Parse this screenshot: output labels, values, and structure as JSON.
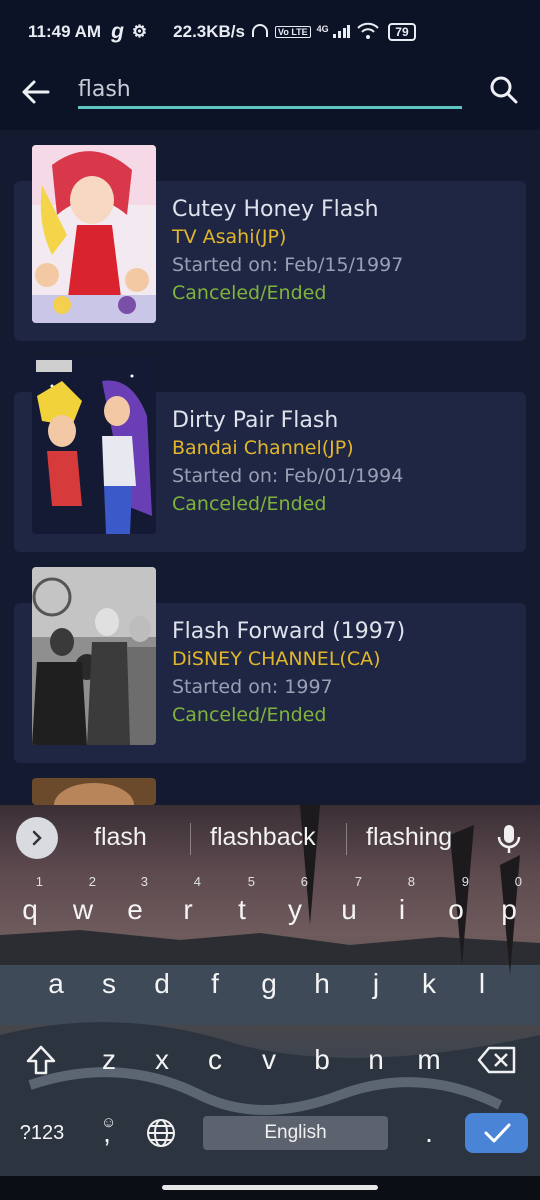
{
  "status_bar": {
    "time": "11:49 AM",
    "g_icon": "g",
    "network_speed": "22.3KB/s",
    "headset_icon": "headset-icon",
    "volte": "Vo LTE",
    "signal": "4G",
    "battery": "79"
  },
  "search": {
    "value": "flash",
    "back_icon": "arrow-back-icon",
    "search_icon": "search-icon"
  },
  "results": [
    {
      "title": "Cutey Honey Flash",
      "network": "TV Asahi(JP)",
      "started": "Started on: Feb/15/1997",
      "status": "Canceled/Ended"
    },
    {
      "title": "Dirty Pair Flash",
      "network": "Bandai Channel(JP)",
      "started": "Started on: Feb/01/1994",
      "status": "Canceled/Ended"
    },
    {
      "title": "Flash Forward (1997)",
      "network": "DiSNEY CHANNEL(CA)",
      "started": "Started on: 1997",
      "status": "Canceled/Ended"
    }
  ],
  "keyboard": {
    "suggestions": [
      "flash",
      "flashback",
      "flashing"
    ],
    "row1": [
      {
        "k": "q",
        "n": "1"
      },
      {
        "k": "w",
        "n": "2"
      },
      {
        "k": "e",
        "n": "3"
      },
      {
        "k": "r",
        "n": "4"
      },
      {
        "k": "t",
        "n": "5"
      },
      {
        "k": "y",
        "n": "6"
      },
      {
        "k": "u",
        "n": "7"
      },
      {
        "k": "i",
        "n": "8"
      },
      {
        "k": "o",
        "n": "9"
      },
      {
        "k": "p",
        "n": "0"
      }
    ],
    "row2": [
      "a",
      "s",
      "d",
      "f",
      "g",
      "h",
      "j",
      "k",
      "l"
    ],
    "row3": [
      "z",
      "x",
      "c",
      "v",
      "b",
      "n",
      "m"
    ],
    "symbols_label": "?123",
    "comma_label": ",",
    "period_label": ".",
    "space_label": "English",
    "colors": {
      "enter": "#4a84d7"
    }
  },
  "colors": {
    "background": "#141b30",
    "card": "#1e2644",
    "accent_underline": "#5fc5c0",
    "network": "#e2b62a",
    "status": "#7fb43a"
  }
}
